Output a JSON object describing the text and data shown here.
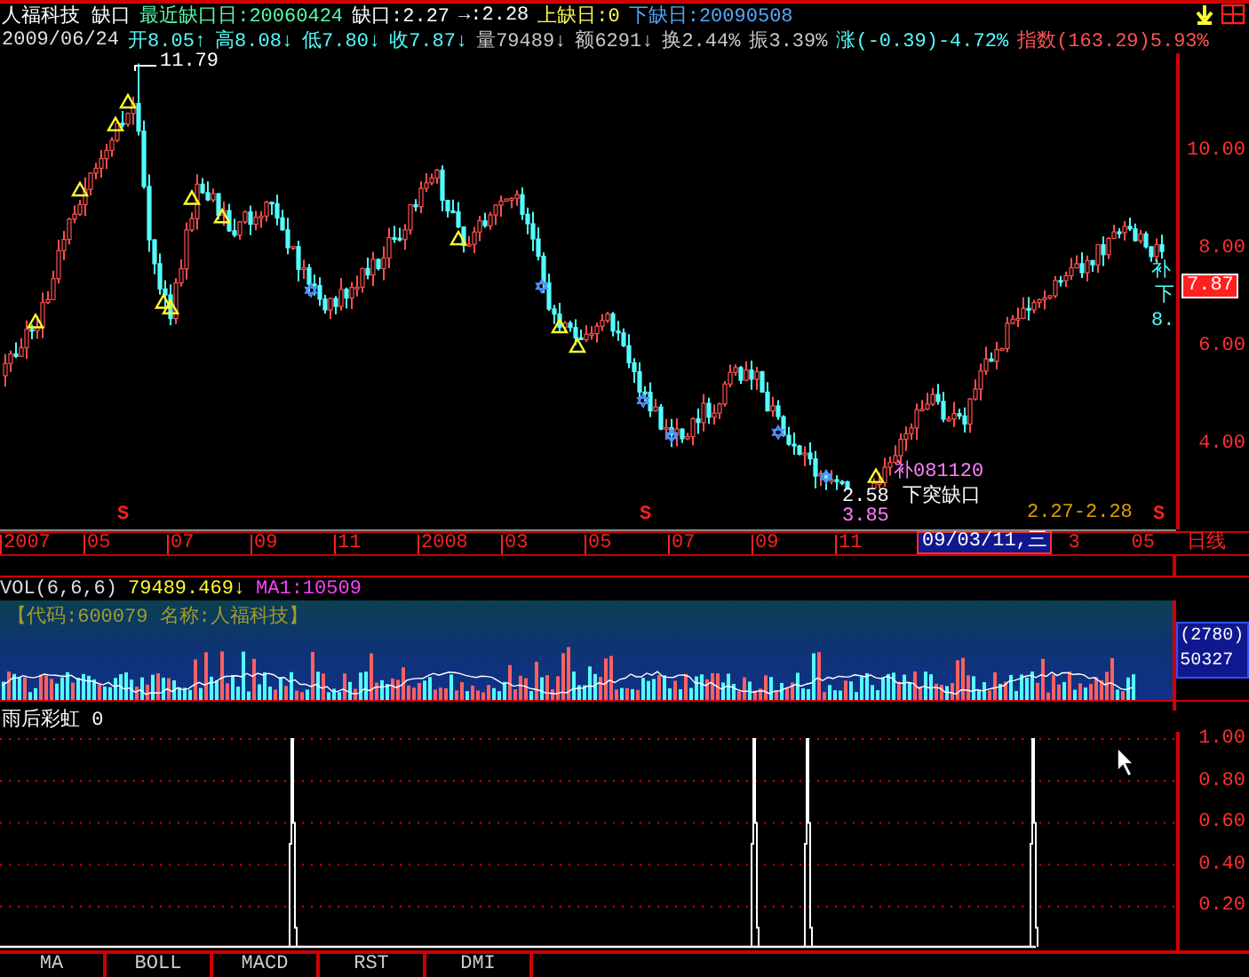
{
  "header_line_1": [
    {
      "text": "人福科技 缺口",
      "color": "#ffffff"
    },
    {
      "text": "最近缺口日:20060424",
      "color": "#54fcac"
    },
    {
      "text": "缺口:2.27",
      "color": "#ffffff"
    },
    {
      "text": "→:2.28",
      "color": "#ffffff"
    },
    {
      "text": "上缺日:0",
      "color": "#fcfc54"
    },
    {
      "text": "下缺日:20090508",
      "color": "#54a8fc"
    }
  ],
  "header_line_2": [
    {
      "text": "2009/06/24",
      "color": "#e0e0e0"
    },
    {
      "text": "开8.05↑",
      "color": "#54fcfc"
    },
    {
      "text": "高8.08↓",
      "color": "#54fcfc"
    },
    {
      "text": "低7.80↓",
      "color": "#54fcfc"
    },
    {
      "text": "收7.87↓",
      "color": "#54fcfc"
    },
    {
      "text": "量79489↓",
      "color": "#c8c8c8"
    },
    {
      "text": "额6291↓",
      "color": "#c8c8c8"
    },
    {
      "text": "换2.44%",
      "color": "#c8c8c8"
    },
    {
      "text": "振3.39%",
      "color": "#c8c8c8"
    },
    {
      "text": "涨(-0.39)-4.72%",
      "color": "#54fcfc"
    },
    {
      "text": "指数(163.29)5.93%",
      "color": "#fc5454"
    }
  ],
  "price_chart": {
    "annotations": [
      "11.79",
      "补",
      "下",
      "8.",
      "补081120",
      "下突缺口",
      "2.58",
      "3.85",
      "2.27-2.28"
    ],
    "signals": [
      "S",
      "S",
      "S"
    ],
    "price_axis": [
      "10.00",
      "8.00",
      "6.00",
      "4.00"
    ],
    "price_tag": "7.87"
  },
  "date_axis": {
    "labels": [
      "2007",
      "05",
      "07",
      "09",
      "11",
      "2008",
      "03",
      "05",
      "07",
      "09",
      "11"
    ],
    "cursor_date": "09/03/11,三",
    "right_labels": [
      "3",
      "05"
    ],
    "period": "日线"
  },
  "volume": {
    "title": "VOL(6,6,6)",
    "value": "79489.469↓",
    "ma": "MA1:10509",
    "stock_info": "【代码:600079 名称:人福科技】",
    "axis_lines": [
      "(2780)",
      "50327"
    ]
  },
  "indicator": {
    "title": "雨后彩虹 0",
    "axis": [
      "1.00",
      "0.80",
      "0.60",
      "0.40",
      "0.20"
    ]
  },
  "tabs": [
    {
      "label": "MA"
    },
    {
      "label": "BOLL"
    },
    {
      "label": "MACD"
    },
    {
      "label": "RST"
    },
    {
      "label": "DMI"
    }
  ]
}
